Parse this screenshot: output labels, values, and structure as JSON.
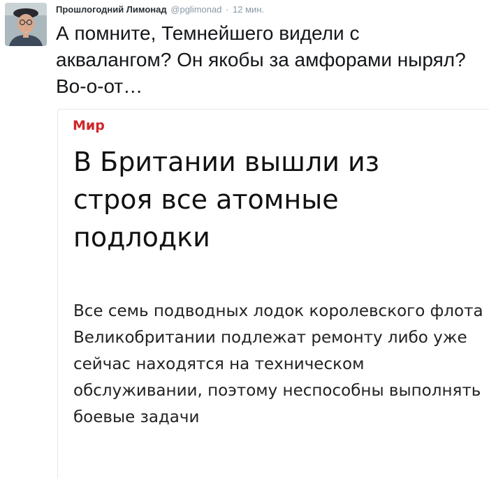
{
  "tweet": {
    "author": {
      "display_name": "Прошлогодний Лимонад",
      "handle": "@pglimonad",
      "avatar_icon": "user-avatar-photo"
    },
    "separator": "·",
    "timestamp": "12 мин.",
    "text": "А помните, Темнейшего видели с аквалангом? Он якобы за амфорами нырял? Во-о-от…"
  },
  "card": {
    "category": "Мир",
    "headline": "В Британии вышли из строя все атомные подлодки",
    "lead": "Все семь подводных лодок королевского флота Великобритании подлежат ремонту либо уже сейчас находятся на техническом обслуживании, поэтому неспособны выполнять боевые задачи",
    "category_color": "#d0262b"
  },
  "colors": {
    "secondary_text": "#8899a6",
    "primary_text": "#14171a",
    "card_border": "#e1e8ed"
  }
}
